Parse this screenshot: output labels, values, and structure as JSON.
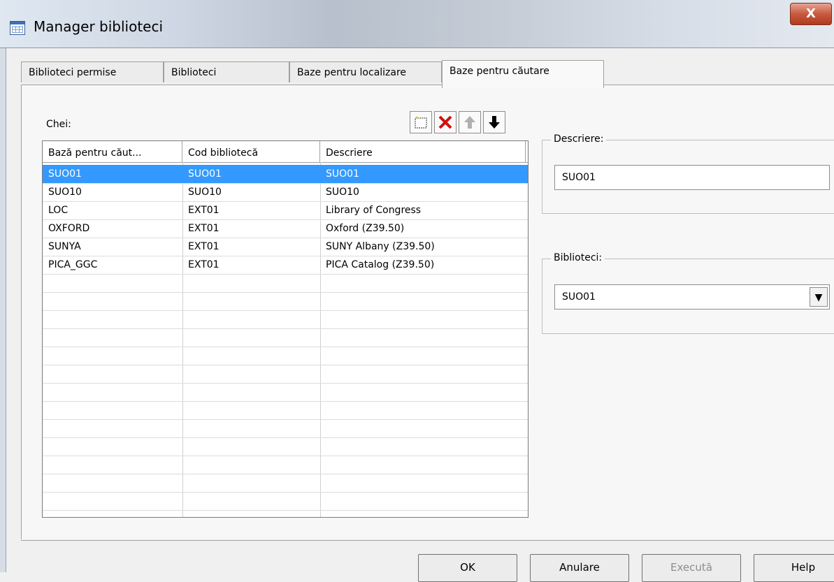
{
  "window": {
    "title": "Manager biblioteci",
    "close_label": "X"
  },
  "tabs": [
    {
      "label": "Biblioteci permise",
      "active": false
    },
    {
      "label": "Biblioteci",
      "active": false
    },
    {
      "label": "Baze pentru localizare",
      "active": false
    },
    {
      "label": "Baze pentru căutare",
      "active": true
    }
  ],
  "keys": {
    "label": "Chei:",
    "columns": [
      "Bază pentru căut...",
      "Cod bibliotecă",
      "Descriere"
    ],
    "rows": [
      [
        "SUO01",
        "SUO01",
        "SUO01"
      ],
      [
        "SUO10",
        "SUO10",
        "SUO10"
      ],
      [
        "LOC",
        "EXT01",
        "Library of Congress"
      ],
      [
        "OXFORD",
        "EXT01",
        "Oxford (Z39.50)"
      ],
      [
        "SUNYA",
        "EXT01",
        "SUNY Albany (Z39.50)"
      ],
      [
        "PICA_GGC",
        "EXT01",
        "PICA Catalog (Z39.50)"
      ]
    ],
    "selected_row": 0
  },
  "toolbar": {
    "icons": [
      "new-icon",
      "delete-icon",
      "move-up-icon",
      "move-down-icon"
    ]
  },
  "description": {
    "label": "Descriere:",
    "value": "SUO01"
  },
  "libraries": {
    "label": "Biblioteci:",
    "value": "SUO01"
  },
  "buttons": {
    "ok": "OK",
    "cancel": "Anulare",
    "execute": "Execută",
    "help": "Help"
  },
  "colors": {
    "selection": "#3399ff",
    "close": "#c75a3f"
  }
}
